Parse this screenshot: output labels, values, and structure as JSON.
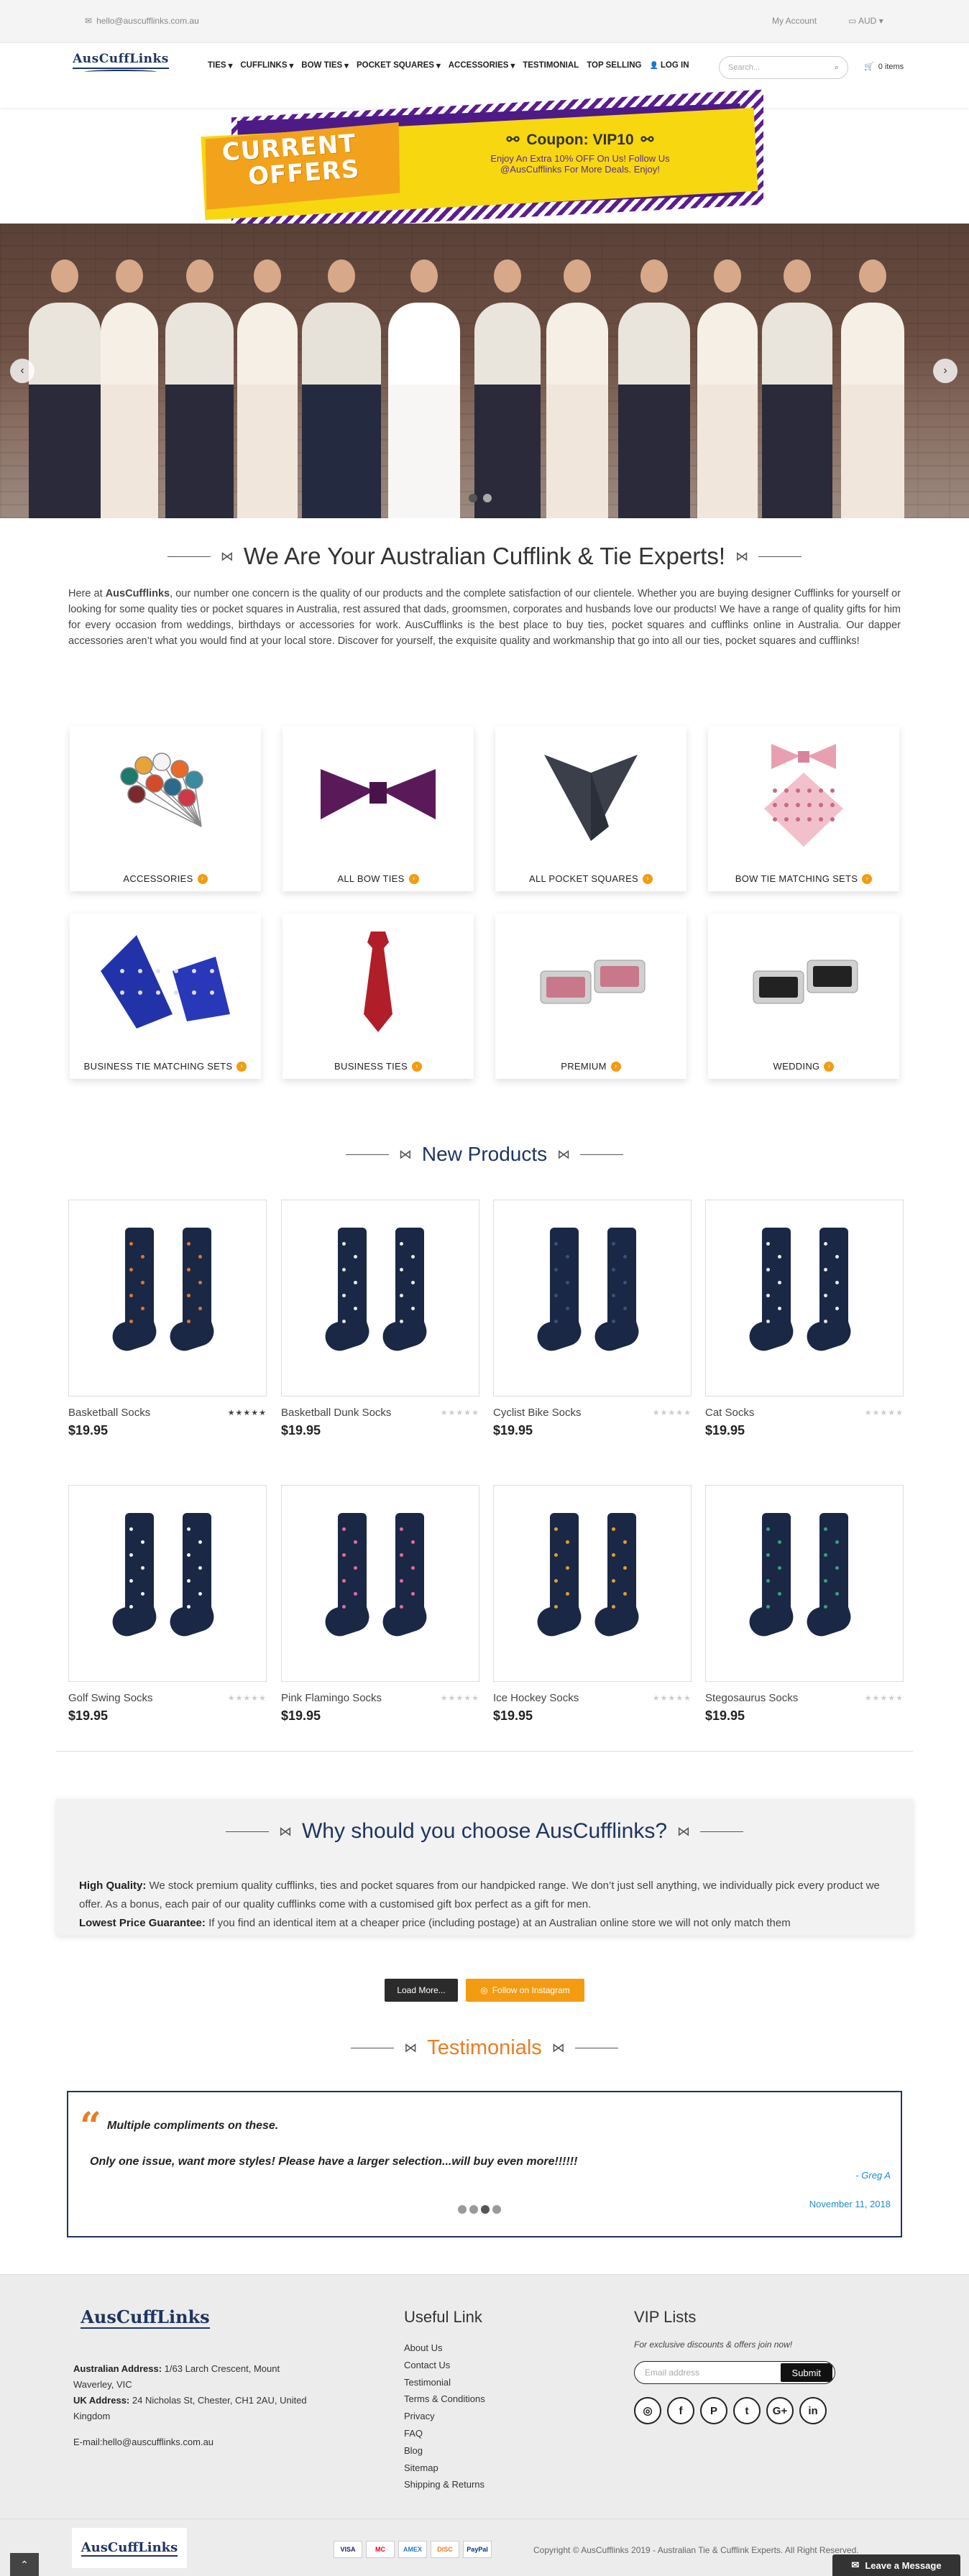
{
  "topbar": {
    "email": "hello@auscufflinks.com.au",
    "account": "My Account",
    "currency": "AUD"
  },
  "header": {
    "logo_text": "AusCuffLinks",
    "nav": [
      {
        "label": "TIES",
        "has_dropdown": true
      },
      {
        "label": "CUFFLINKS",
        "has_dropdown": true
      },
      {
        "label": "BOW TIES",
        "has_dropdown": true
      },
      {
        "label": "POCKET SQUARES",
        "has_dropdown": true
      },
      {
        "label": "ACCESSORIES",
        "has_dropdown": true
      },
      {
        "label": "TESTIMONIAL",
        "has_dropdown": false
      },
      {
        "label": "TOP SELLING",
        "has_dropdown": false
      },
      {
        "label": "LOG IN",
        "has_dropdown": false
      }
    ],
    "search_placeholder": "Search...",
    "cart_label": "0 items"
  },
  "offers": {
    "title_line1": "CURRENT",
    "title_line2": "OFFERS",
    "coupon": "Coupon: VIP10",
    "line1": "Enjoy An Extra 10% OFF On Us! Follow Us",
    "line2": "@AusCufflinks For More Deals. Enjoy!"
  },
  "hero": {
    "slides": 2,
    "active_slide": 1
  },
  "intro": {
    "title": "We Are Your Australian Cufflink & Tie Experts!",
    "text_before_brand": "Here at ",
    "brand": "AusCufflinks",
    "text_after_brand": ", our number one concern is the quality of our products and the complete satisfaction of our clientele. Whether you are buying designer Cufflinks for yourself or looking for some quality ties or pocket squares in Australia, rest assured that dads, groomsmen, corporates and husbands love our products! We have a range of quality gifts for him for every occasion from weddings, birthdays or accessories for work. AusCufflinks is the best place to buy ties, pocket squares and cufflinks online in Australia. Our dapper accessories aren’t what you would find at your local store. Discover for yourself, the exquisite quality and workmanship that go into all our ties, pocket squares and cufflinks!"
  },
  "categories": [
    {
      "label": "ACCESSORIES",
      "icon": "lapel-pins-icon"
    },
    {
      "label": "ALL BOW TIES",
      "icon": "bow-tie-icon"
    },
    {
      "label": "ALL POCKET SQUARES",
      "icon": "pocket-square-icon"
    },
    {
      "label": "BOW TIE MATCHING SETS",
      "icon": "bow-tie-set-icon"
    },
    {
      "label": "BUSINESS TIE MATCHING SETS",
      "icon": "tie-set-icon"
    },
    {
      "label": "BUSINESS TIES",
      "icon": "tie-icon"
    },
    {
      "label": "PREMIUM",
      "icon": "cufflinks-icon"
    },
    {
      "label": "WEDDING",
      "icon": "cufflinks-icon"
    }
  ],
  "new_products": {
    "title": "New Products",
    "items": [
      {
        "name": "Basketball Socks",
        "price": "$19.95",
        "stars": "★★★★★",
        "rated": true,
        "accent": "#d9773a"
      },
      {
        "name": "Basketball Dunk Socks",
        "price": "$19.95",
        "stars": "★★★★★",
        "rated": false,
        "accent": "#e8e8e8"
      },
      {
        "name": "Cyclist Bike Socks",
        "price": "$19.95",
        "stars": "★★★★★",
        "rated": false,
        "accent": "#3a4f7a"
      },
      {
        "name": "Cat Socks",
        "price": "$19.95",
        "stars": "★★★★★",
        "rated": false,
        "accent": "#e8e8e8"
      },
      {
        "name": "Golf Swing Socks",
        "price": "$19.95",
        "stars": "★★★★★",
        "rated": false,
        "accent": "#f0f0f0"
      },
      {
        "name": "Pink Flamingo Socks",
        "price": "$19.95",
        "stars": "★★★★★",
        "rated": false,
        "accent": "#e86a9a"
      },
      {
        "name": "Ice Hockey Socks",
        "price": "$19.95",
        "stars": "★★★★★",
        "rated": false,
        "accent": "#e0a030"
      },
      {
        "name": "Stegosaurus Socks",
        "price": "$19.95",
        "stars": "★★★★★",
        "rated": false,
        "accent": "#3aa07a"
      }
    ]
  },
  "why": {
    "title": "Why should you choose AusCufflinks?",
    "p1_label": "High Quality:",
    "p1_text": " We stock premium quality cufflinks, ties and pocket squares from our handpicked range. We don’t just sell anything, we individually pick every product we offer. As a bonus, each pair of our quality cufflinks come with a customised gift box perfect as a gift for men.",
    "p2_label": "Lowest Price Guarantee:",
    "p2_text": " If you find an identical item at a cheaper price (including postage) at an Australian online store we will not only match them"
  },
  "buttons": {
    "load_more": "Load More...",
    "instagram": "Follow on Instagram"
  },
  "testimonials": {
    "title": "Testimonials",
    "quote_mark": "“",
    "heading": "Multiple compliments on these.",
    "body": "Only one issue, want more styles! Please have a larger selection...will buy even more!!!!!!",
    "author": "- Greg A",
    "date": "November 11, 2018",
    "dots": 4,
    "active_dot": 3
  },
  "footer": {
    "address_label_au": "Australian Address:",
    "address_au": " 1/63 Larch Crescent, Mount Waverley, VIC",
    "address_label_uk": "UK Address:",
    "address_uk": " 24 Nicholas St, Chester, CH1 2AU, United Kingdom",
    "email_line": "E-mail:hello@auscufflinks.com.au",
    "useful_title": "Useful Link",
    "links": [
      "About Us",
      "Contact Us",
      "Testimonial",
      "Terms & Conditions",
      "Privacy",
      "FAQ",
      "Blog",
      "Sitemap",
      "Shipping & Returns"
    ],
    "vip_title": "VIP Lists",
    "vip_sub": "For exclusive discounts & offers join now!",
    "vip_placeholder": "Email address",
    "vip_submit": "Submit",
    "socials": [
      "instagram-icon",
      "facebook-icon",
      "pinterest-icon",
      "twitter-icon",
      "google-plus-icon",
      "linkedin-icon"
    ],
    "social_glyphs": [
      "◎",
      "f",
      "P",
      "t",
      "G+",
      "in"
    ]
  },
  "bottom": {
    "payments": [
      "VISA",
      "MC",
      "AMEX",
      "DISC",
      "PayPal"
    ],
    "copyright": "Copyright © AusCufflinks 2019 - Australian Tie & Cufflink Experts. All Right Reserved.",
    "leave_message": "Leave a Message"
  }
}
